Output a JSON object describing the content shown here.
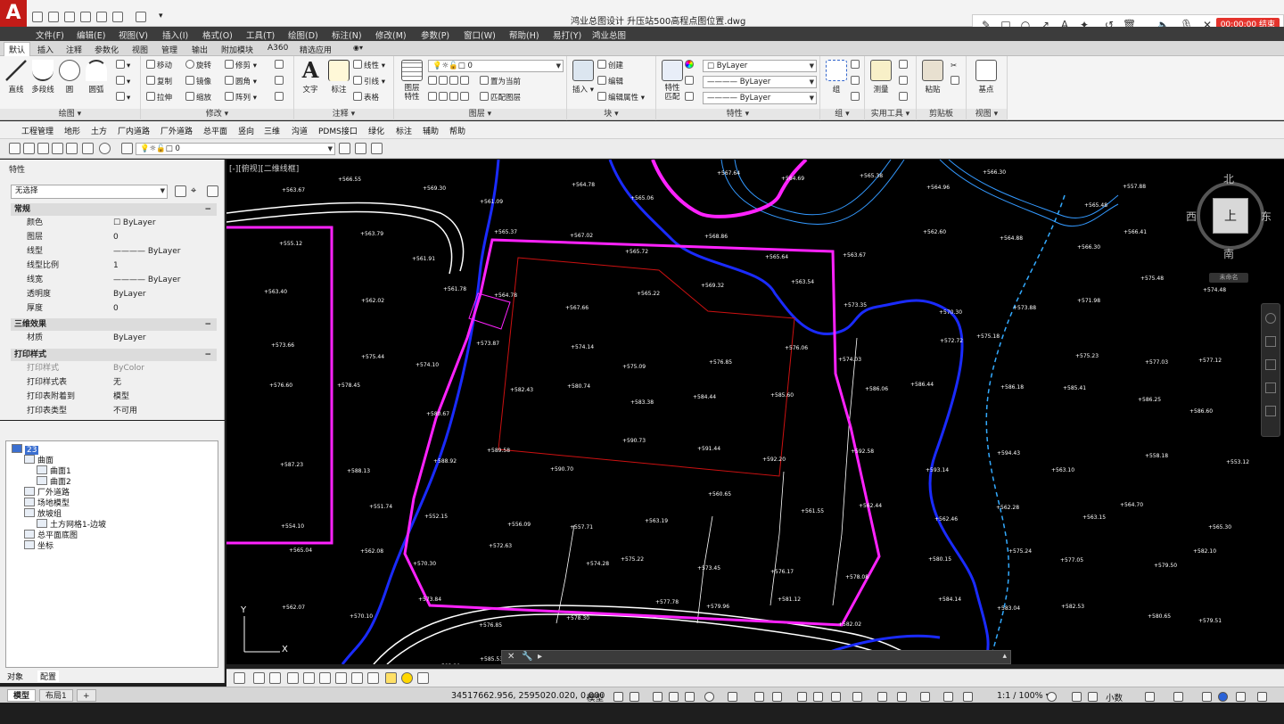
{
  "app": {
    "logo": "A",
    "title": "鸿业总图设计    升压站500高程点图位置.dwg"
  },
  "recorder": {
    "time_label": "00:00:00 结束"
  },
  "menu": [
    "文件(F)",
    "编辑(E)",
    "视图(V)",
    "插入(I)",
    "格式(O)",
    "工具(T)",
    "绘图(D)",
    "标注(N)",
    "修改(M)",
    "参数(P)",
    "窗口(W)",
    "帮助(H)",
    "易打(Y)",
    "鸿业总图"
  ],
  "ribbon_tabs": [
    "默认",
    "插入",
    "注释",
    "参数化",
    "视图",
    "管理",
    "输出",
    "附加模块",
    "A360",
    "精选应用"
  ],
  "ribbon": {
    "draw": {
      "label": "绘图 ▾",
      "line": "直线",
      "polyline": "多段线",
      "circle": "圆",
      "arc": "圆弧"
    },
    "modify": {
      "label": "修改 ▾",
      "move": "移动",
      "rotate": "旋转",
      "trim": "修剪",
      "copy": "复制",
      "mirror": "镜像",
      "fillet": "圆角",
      "stretch": "拉伸",
      "scale": "缩放",
      "array": "阵列"
    },
    "annotation": {
      "label": "注释 ▾",
      "text": "文字",
      "dimension": "标注",
      "linear": "线性",
      "leader": "引线",
      "table": "表格"
    },
    "layers": {
      "label": "图层 ▾",
      "layer_props": "图层\n特性",
      "layer_value": "0",
      "set_current": "置为当前",
      "match_layer": "匹配图层"
    },
    "block": {
      "label": "块 ▾",
      "insert": "插入",
      "create": "创建",
      "edit": "编辑",
      "edit_attrs": "编辑属性"
    },
    "properties": {
      "label": "特性 ▾",
      "match": "特性\n匹配",
      "color": "ByLayer",
      "linetype": "ByLayer",
      "lineweight": "ByLayer"
    },
    "groups": {
      "label": "组 ▾",
      "group": "组"
    },
    "utilities": {
      "label": "实用工具 ▾",
      "measure": "测量"
    },
    "clipboard": {
      "label": "剪贴板",
      "paste": "粘贴"
    },
    "view": {
      "label": "视图 ▾",
      "base": "基点"
    }
  },
  "custom_menu": [
    "工程管理",
    "地形",
    "土方",
    "厂内道路",
    "厂外道路",
    "总平面",
    "竖向",
    "三维",
    "沟道",
    "PDMS接口",
    "绿化",
    "标注",
    "辅助",
    "帮助"
  ],
  "layer_toolbar": {
    "layer_value": "0"
  },
  "properties_panel": {
    "title": "特性",
    "selection": "无选择",
    "sections": {
      "general": "常规",
      "threed": "三维效果",
      "plot": "打印样式"
    },
    "general_rows": [
      {
        "k": "颜色",
        "v": "☐ ByLayer"
      },
      {
        "k": "图层",
        "v": "0"
      },
      {
        "k": "线型",
        "v": "———— ByLayer"
      },
      {
        "k": "线型比例",
        "v": "1"
      },
      {
        "k": "线宽",
        "v": "———— ByLayer"
      },
      {
        "k": "透明度",
        "v": "ByLayer"
      },
      {
        "k": "厚度",
        "v": "0"
      }
    ],
    "threed_rows": [
      {
        "k": "材质",
        "v": "ByLayer"
      }
    ],
    "plot_rows": [
      {
        "k": "打印样式",
        "v": "ByColor"
      },
      {
        "k": "打印样式表",
        "v": "无"
      },
      {
        "k": "打印表附着到",
        "v": "模型"
      },
      {
        "k": "打印表类型",
        "v": "不可用"
      }
    ]
  },
  "tree": {
    "items": [
      {
        "label": "23",
        "indent": 0
      },
      {
        "label": "曲面",
        "indent": 1
      },
      {
        "label": "曲面1",
        "indent": 2
      },
      {
        "label": "曲面2",
        "indent": 2
      },
      {
        "label": "厂外道路",
        "indent": 1
      },
      {
        "label": "场地模型",
        "indent": 1
      },
      {
        "label": "放坡组",
        "indent": 1
      },
      {
        "label": "土方网格1-边坡",
        "indent": 2
      },
      {
        "label": "总平面底图",
        "indent": 1
      },
      {
        "label": "坐标",
        "indent": 1
      }
    ],
    "tabs": [
      "对象",
      "配置"
    ]
  },
  "canvas": {
    "viewport_label": "[-][俯视][二维线框]",
    "viewcube": {
      "north": "北",
      "south": "南",
      "east": "东",
      "west": "西",
      "top": "上",
      "wcs": "未命名"
    },
    "elevation_labels": [
      "+563.67",
      "+566.55",
      "+569.30",
      "+561.09",
      "+564.78",
      "+565.06",
      "+567.64",
      "+564.69",
      "+565.38",
      "+564.96",
      "+566.30",
      "+565.48",
      "+557.88",
      "+557.78",
      "+555.12",
      "+563.79",
      "+561.91",
      "+565.37",
      "+567.02",
      "+565.72",
      "+568.86",
      "+565.64",
      "+563.67",
      "+562.60",
      "+564.88",
      "+566.30",
      "+566.41",
      "+563.30",
      "+563.40",
      "+562.02",
      "+561.78",
      "+564.78",
      "+567.66",
      "+565.22",
      "+569.32",
      "+563.54",
      "+573.35",
      "+570.30",
      "+573.88",
      "+571.98",
      "+575.48",
      "+574.48",
      "+573.66",
      "+575.44",
      "+574.10",
      "+573.87",
      "+574.14",
      "+575.09",
      "+576.85",
      "+576.06",
      "+574.03",
      "+572.72",
      "+575.18",
      "+575.23",
      "+577.03",
      "+577.12",
      "+576.60",
      "+578.45",
      "+580.67",
      "+582.43",
      "+580.74",
      "+583.38",
      "+584.44",
      "+585.60",
      "+586.06",
      "+586.44",
      "+586.18",
      "+585.41",
      "+586.25",
      "+586.60",
      "+587.23",
      "+588.13",
      "+588.92",
      "+589.58",
      "+590.70",
      "+590.73",
      "+591.44",
      "+592.20",
      "+592.58",
      "+593.14",
      "+594.43",
      "+563.10",
      "+558.18",
      "+553.12",
      "+554.10",
      "+551.74",
      "+552.15",
      "+556.09",
      "+557.71",
      "+563.19",
      "+560.65",
      "+561.55",
      "+562.44",
      "+562.46",
      "+562.28",
      "+563.15",
      "+564.70",
      "+565.30",
      "+565.04",
      "+562.08",
      "+570.30",
      "+572.63",
      "+574.28",
      "+575.22",
      "+573.45",
      "+576.17",
      "+578.08",
      "+580.15",
      "+575.24",
      "+577.05",
      "+579.50",
      "+582.10",
      "+562.07",
      "+570.10",
      "+573.84",
      "+576.85",
      "+578.30",
      "+577.78",
      "+579.96",
      "+581.12",
      "+582.02",
      "+584.14",
      "+583.04",
      "+582.53",
      "+580.65",
      "+579.51",
      "+577.96",
      "+581.29",
      "+583.20",
      "+585.53",
      "+584.40",
      "+583.30",
      "+587.97"
    ]
  },
  "layout_tabs": [
    "模型",
    "布局1",
    "+"
  ],
  "status": {
    "coords": "34517662.956, 2595020.020, 0.000",
    "model": "模型",
    "scale": "1:1 / 100% ▾",
    "units": "小数"
  },
  "colors": {
    "magenta": "#ff22ff",
    "blue": "#2233ff",
    "red": "#cc1111",
    "white": "#ffffff",
    "cyan": "#33aaff",
    "recording": "#e4332c",
    "logo": "#c21b17"
  }
}
